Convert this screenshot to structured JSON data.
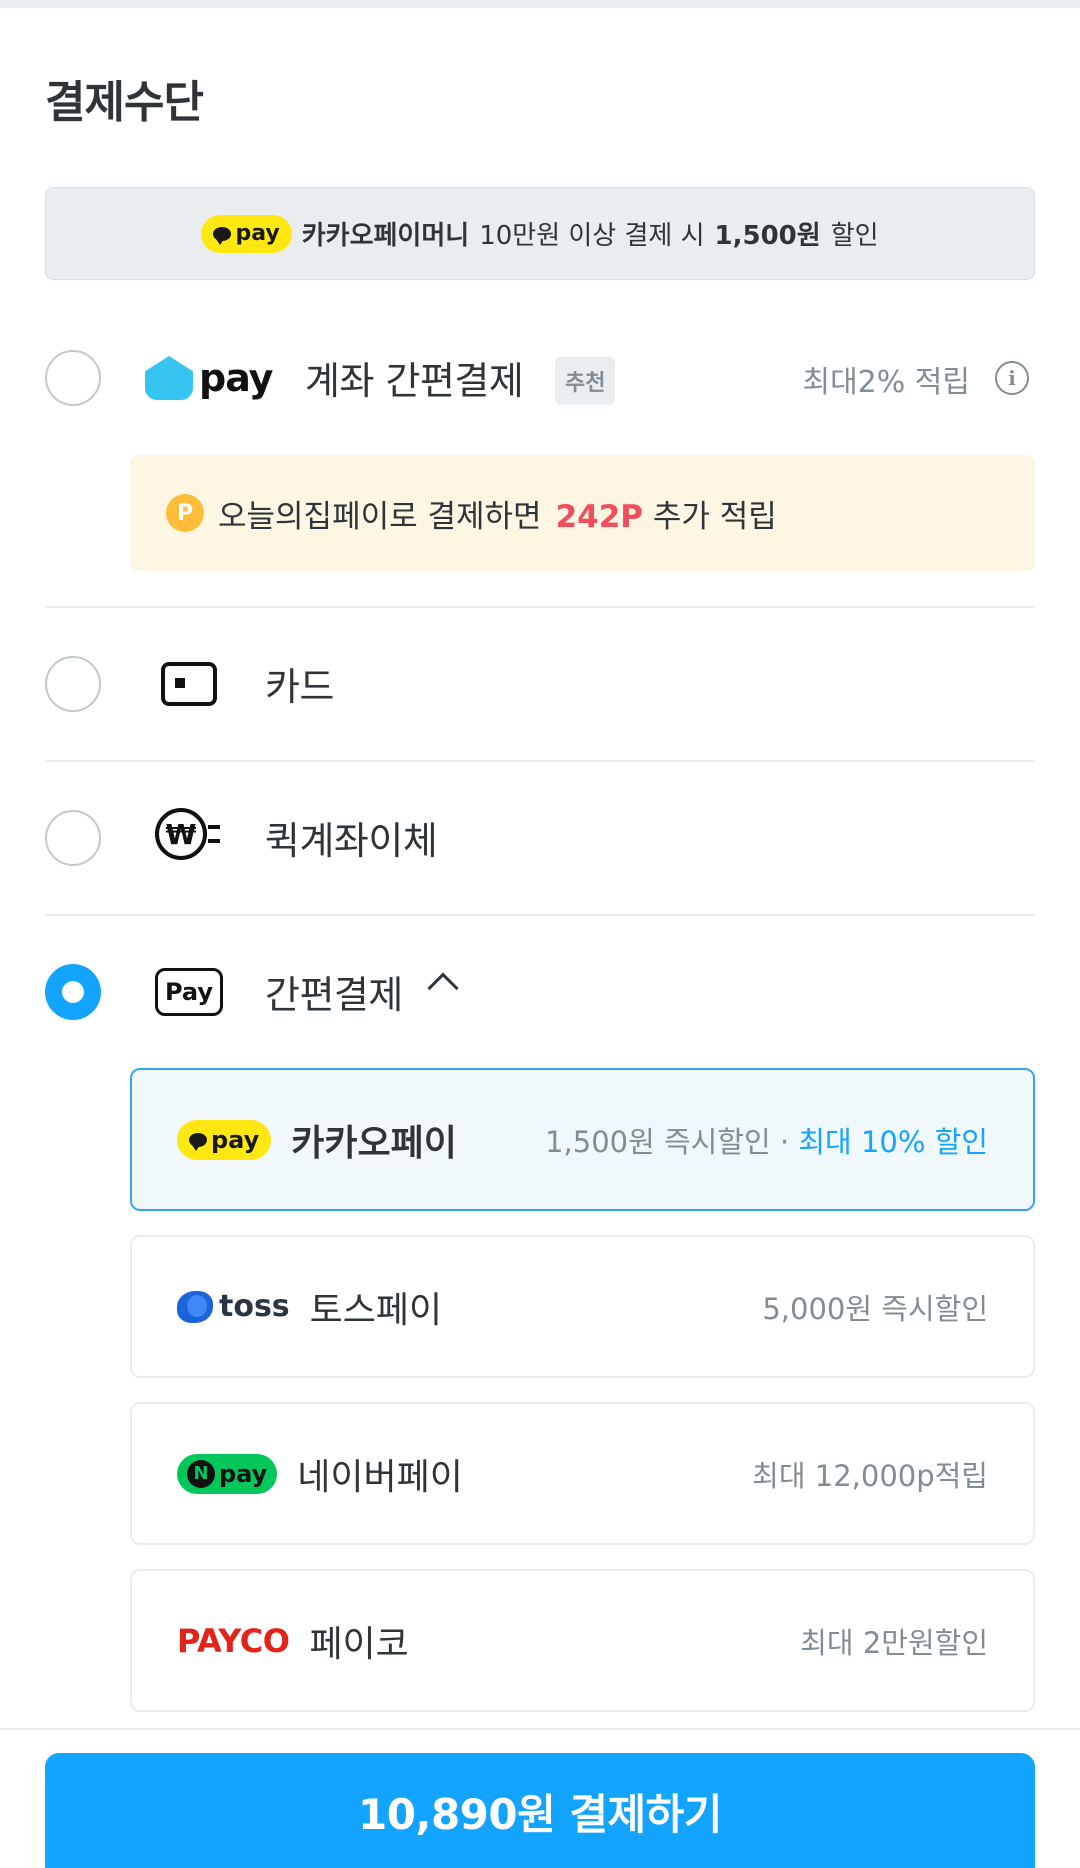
{
  "title": "결제수단",
  "banner": {
    "pay_icon_text": "pay",
    "brand": "카카오페이머니",
    "condition": "10만원 이상 결제 시",
    "discount": "1,500원",
    "suffix": "할인"
  },
  "options": {
    "ohou": {
      "logo_text": "pay",
      "label": "계좌 간편결제",
      "badge": "추천",
      "note": "최대2% 적립",
      "info_glyph": "i",
      "point_coin": "P",
      "point_prefix": "오늘의집페이로 결제하면",
      "point_value": "242P",
      "point_suffix": "추가 적립"
    },
    "card": {
      "label": "카드"
    },
    "quick": {
      "label": "퀵계좌이체",
      "icon_glyph": "₩"
    },
    "simple": {
      "label": "간편결제",
      "icon_text": "Pay"
    }
  },
  "simple_pay": {
    "kakao": {
      "logo": "pay",
      "name": "카카오페이",
      "note": "1,500원 즉시할인",
      "note_sep": "·",
      "note_highlight": "최대 10% 할인"
    },
    "toss": {
      "logo": "toss",
      "name": "토스페이",
      "note": "5,000원 즉시할인"
    },
    "naver": {
      "logo_n": "N",
      "logo": "pay",
      "name": "네이버페이",
      "note": "최대 12,000p적립"
    },
    "payco": {
      "logo": "PAYCO",
      "name": "페이코",
      "note": "최대 2만원할인"
    }
  },
  "pay_button": "10,890원 결제하기",
  "colors": {
    "accent": "#12a4ff",
    "points": "#f24c5d",
    "kakao_yellow": "#ffe812",
    "naver_green": "#03c75a",
    "payco_red": "#e2231a"
  }
}
